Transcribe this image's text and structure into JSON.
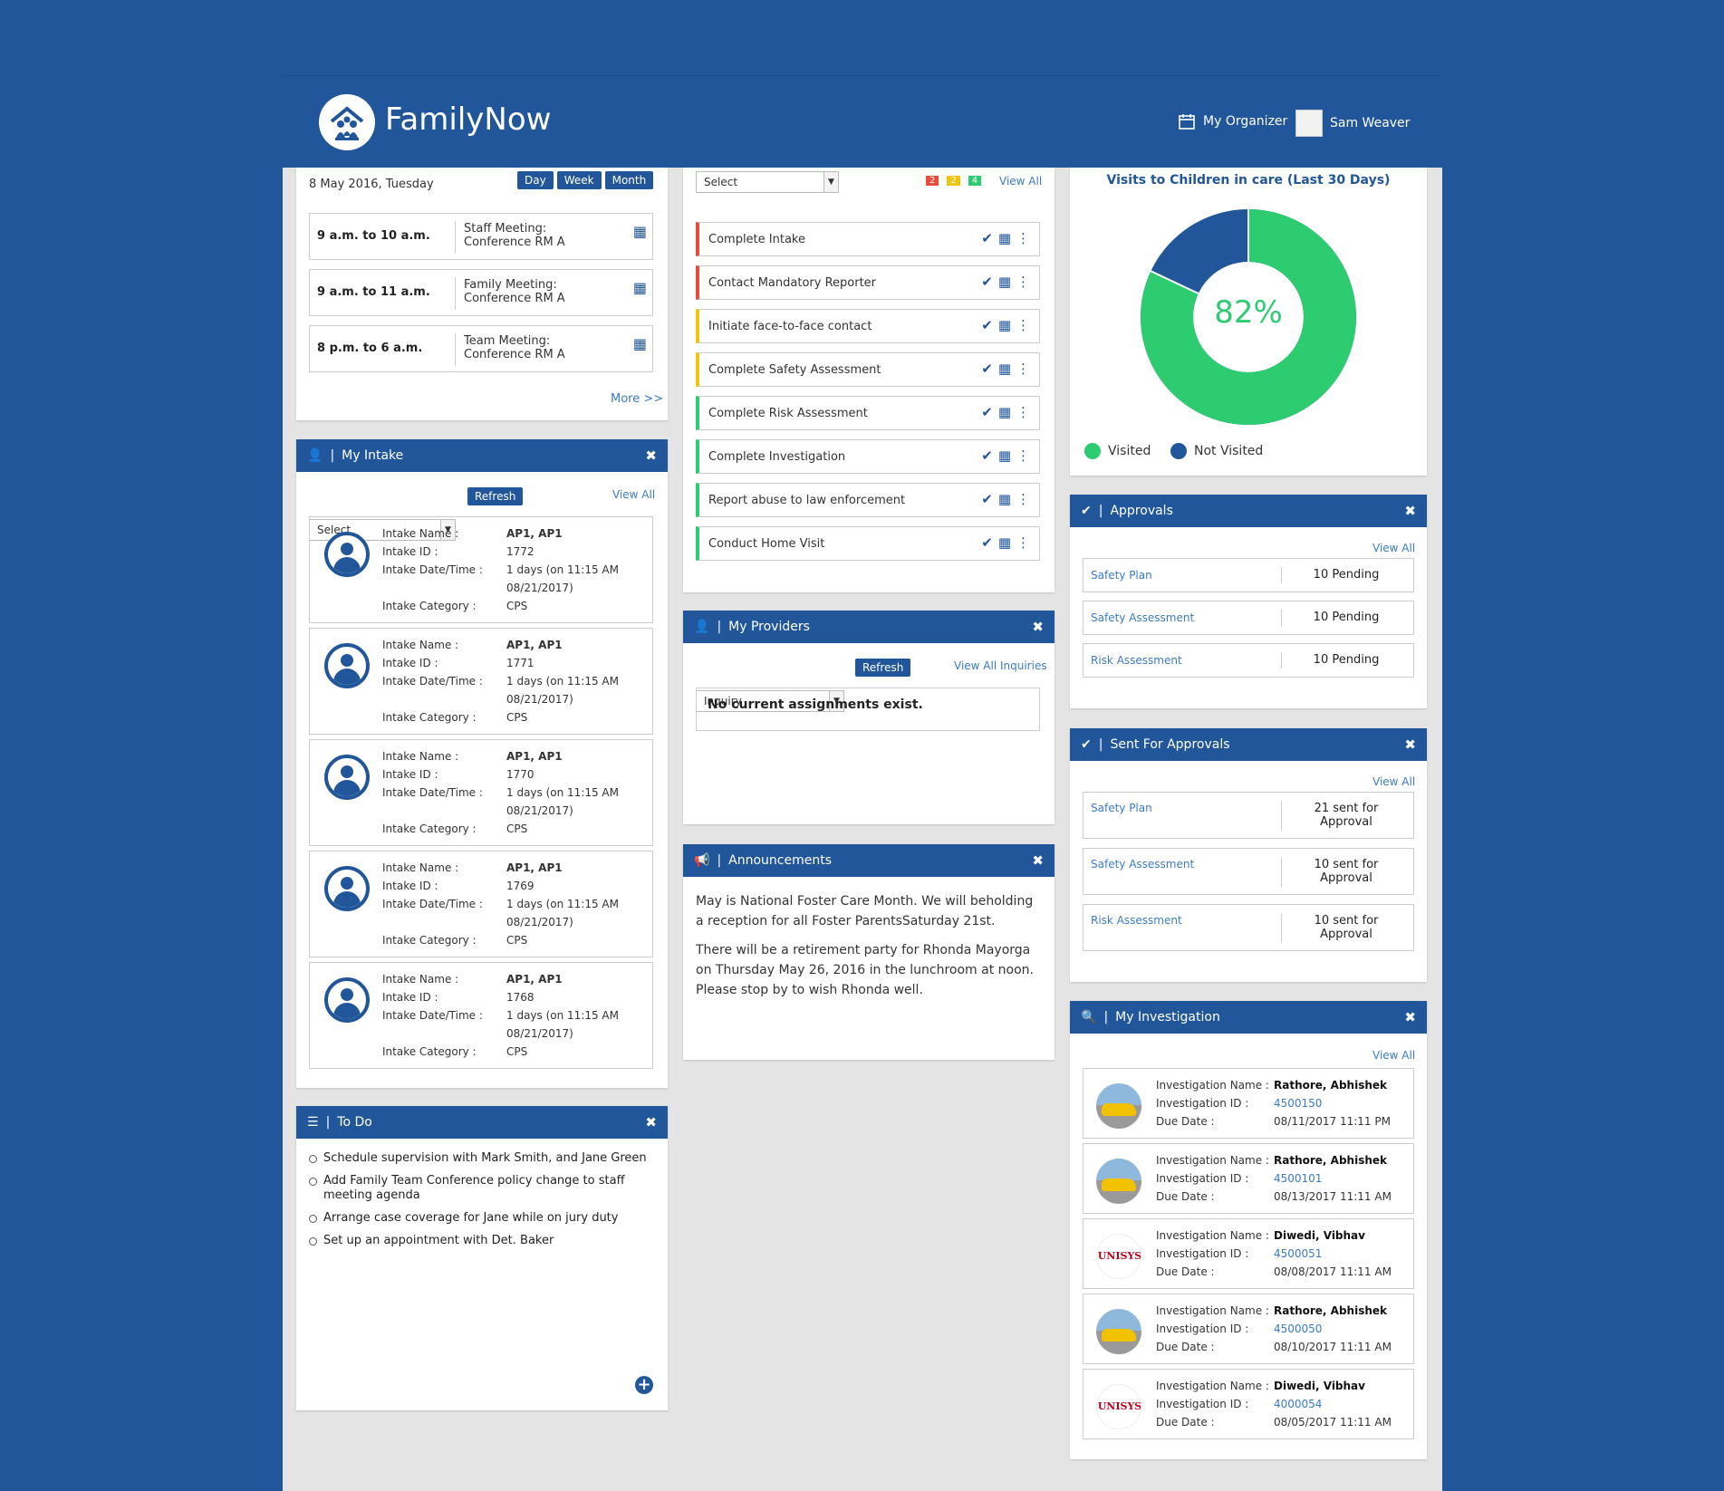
{
  "header": {
    "brand": "FamilyNow",
    "organizer_label": "My Organizer",
    "user_name": "Sam Weaver"
  },
  "calendar": {
    "date": "8 May 2016, Tuesday",
    "view_buttons": [
      "Day",
      "Week",
      "Month"
    ],
    "events": [
      {
        "time": "9 a.m. to 10 a.m.",
        "line1": "Staff Meeting:",
        "line2": "Conference RM A"
      },
      {
        "time": "9 a.m. to 11 a.m.",
        "line1": "Family Meeting:",
        "line2": "Conference RM A"
      },
      {
        "time": "8 p.m. to 6 a.m.",
        "line1": "Team Meeting:",
        "line2": "Conference RM A"
      }
    ],
    "more_link": "More >>"
  },
  "tasks": {
    "select_value": "Select",
    "counts": [
      "2",
      "2",
      "4"
    ],
    "view_all": "View All",
    "items": [
      {
        "label": "Complete Intake",
        "status": "red"
      },
      {
        "label": "Contact Mandatory Reporter",
        "status": "red"
      },
      {
        "label": "Initiate face-to-face contact",
        "status": "yellow"
      },
      {
        "label": "Complete Safety Assessment",
        "status": "yellow"
      },
      {
        "label": "Complete Risk Assessment",
        "status": "green"
      },
      {
        "label": "Complete Investigation",
        "status": "green"
      },
      {
        "label": "Report abuse to law enforcement",
        "status": "green"
      },
      {
        "label": "Conduct Home Visit",
        "status": "green"
      }
    ],
    "status_colors": {
      "red": "#e74c3c",
      "yellow": "#f1c40f",
      "green": "#2ecc71"
    }
  },
  "visits": {
    "title": "Visits to Children in care (Last 30 Days)",
    "percent_label": "82%",
    "visited_fraction": 0.82,
    "legend_visited": "Visited",
    "legend_not_visited": "Not Visited",
    "colors": {
      "visited": "#2ecc71",
      "not_visited": "#21579a"
    }
  },
  "my_intake": {
    "title": "My Intake",
    "select_value": "Select",
    "refresh": "Refresh",
    "view_all": "View All",
    "labels": {
      "name": "Intake Name :",
      "id": "Intake ID :",
      "date": "Intake Date/Time :",
      "category": "Intake Category :"
    },
    "items": [
      {
        "name": "AP1, AP1",
        "id": "1772",
        "date1": "1 days (on 11:15 AM",
        "date2": "08/21/2017)",
        "category": "CPS"
      },
      {
        "name": "AP1, AP1",
        "id": "1771",
        "date1": "1 days (on 11:15 AM",
        "date2": "08/21/2017)",
        "category": "CPS"
      },
      {
        "name": "AP1, AP1",
        "id": "1770",
        "date1": "1 days (on 11:15 AM",
        "date2": "08/21/2017)",
        "category": "CPS"
      },
      {
        "name": "AP1, AP1",
        "id": "1769",
        "date1": "1 days (on 11:15 AM",
        "date2": "08/21/2017)",
        "category": "CPS"
      },
      {
        "name": "AP1, AP1",
        "id": "1768",
        "date1": "1 days (on 11:15 AM",
        "date2": "08/21/2017)",
        "category": "CPS"
      }
    ]
  },
  "providers": {
    "title": "My Providers",
    "select_value": "Inquiry",
    "refresh": "Refresh",
    "view_all": "View All Inquiries",
    "empty_message": "No current assignments exist."
  },
  "announcements": {
    "title": "Announcements",
    "paragraphs": [
      "May is National Foster Care Month. We will beholding a reception for all Foster ParentsSaturday 21st.",
      "There will be a retirement party for Rhonda Mayorga on Thursday May 26, 2016 in the lunchroom at noon. Please stop by to wish Rhonda well."
    ]
  },
  "approvals": {
    "title": "Approvals",
    "view_all": "View All",
    "items": [
      {
        "name": "Safety Plan",
        "value": "10 Pending"
      },
      {
        "name": "Safety Assessment",
        "value": "10 Pending"
      },
      {
        "name": "Risk Assessment",
        "value": "10 Pending"
      }
    ]
  },
  "sent_approvals": {
    "title": "Sent For Approvals",
    "view_all": "View All",
    "items": [
      {
        "name": "Safety Plan",
        "line1": "21 sent for",
        "line2": "Approval"
      },
      {
        "name": "Safety Assessment",
        "line1": "10 sent for",
        "line2": "Approval"
      },
      {
        "name": "Risk Assessment",
        "line1": "10 sent for",
        "line2": "Approval"
      }
    ]
  },
  "todo": {
    "title": "To Do",
    "items": [
      "Schedule supervision with Mark Smith, and Jane Green",
      "Add Family Team Conference policy change to staff meeting agenda",
      "Arrange case coverage for Jane while on jury duty",
      "Set up an appointment with Det. Baker"
    ]
  },
  "investigation": {
    "title": "My Investigation",
    "view_all": "View All",
    "labels": {
      "name": "Investigation Name :",
      "id": "Investigation ID :",
      "due": "Due Date :"
    },
    "logo_text": "UNISYS",
    "items": [
      {
        "name": "Rathore, Abhishek",
        "id": "4500150",
        "due": "08/11/2017 11:11 PM",
        "pic": "car"
      },
      {
        "name": "Rathore, Abhishek",
        "id": "4500101",
        "due": "08/13/2017 11:11 AM",
        "pic": "car"
      },
      {
        "name": "Diwedi, Vibhav",
        "id": "4500051",
        "due": "08/08/2017 11:11 AM",
        "pic": "logo"
      },
      {
        "name": "Rathore, Abhishek",
        "id": "4500050",
        "due": "08/10/2017 11:11 AM",
        "pic": "car"
      },
      {
        "name": "Diwedi, Vibhav",
        "id": "4000054",
        "due": "08/05/2017 11:11 AM",
        "pic": "logo"
      }
    ]
  }
}
